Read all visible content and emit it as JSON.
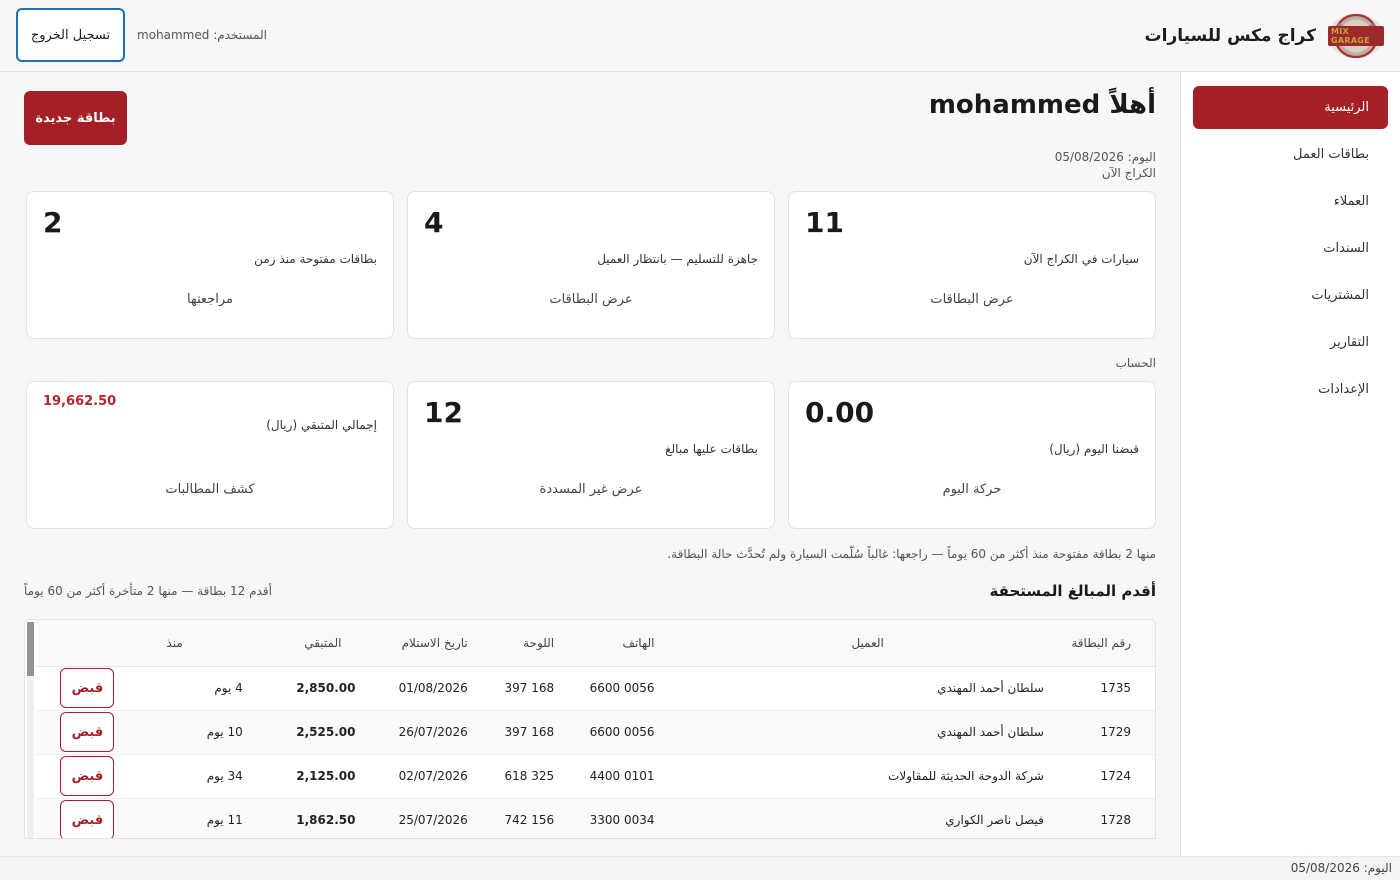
{
  "header": {
    "brand_title": "كراج مكس للسيارات",
    "logo_text": "MIX GARAGE",
    "user_label": "المستخدم: mohammed",
    "logout_label": "تسجيل الخروج"
  },
  "sidebar": {
    "items": [
      {
        "label": "الرئيسية",
        "active": true
      },
      {
        "label": "بطاقات العمل"
      },
      {
        "label": "العملاء"
      },
      {
        "label": "السندات"
      },
      {
        "label": "المشتريات"
      },
      {
        "label": "التقارير"
      },
      {
        "label": "الإعدادات"
      }
    ]
  },
  "main": {
    "greeting": "أهلاً mohammed",
    "today": "اليوم: 05/08/2026",
    "new_card_label": "بطاقة جديدة",
    "garage_section": "الكراج الآن",
    "account_section": "الحساب",
    "garage_cards": [
      {
        "value": "11",
        "label": "سيارات في الكراج الآن",
        "link": "عرض البطاقات"
      },
      {
        "value": "4",
        "label": "جاهزة للتسليم — بانتظار العميل",
        "link": "عرض البطاقات"
      },
      {
        "value": "2",
        "label": "بطاقات مفتوحة منذ زمن",
        "link": "مراجعتها"
      }
    ],
    "account_cards": [
      {
        "value": "0.00",
        "label": "قبضنا اليوم (ريال)",
        "link": "حركة اليوم"
      },
      {
        "value": "12",
        "label": "بطاقات عليها مبالغ",
        "link": "عرض غير المسددة"
      },
      {
        "value": "19,662.50",
        "label": "إجمالي المتبقي (ريال)",
        "link": "كشف المطالبات"
      }
    ],
    "note": "منها 2 بطاقة مفتوحة منذ أكثر من 60 يوماً — راجعها: غالباً سُلّمت السيارة ولم تُحدَّث حالة البطاقة.",
    "oldest_title": "أقدم المبالغ المستحقة",
    "oldest_subtitle": "أقدم 12 بطاقة — منها 2 متأخرة أكثر من 60 يوماً"
  },
  "table": {
    "headers": {
      "card_no": "رقم البطاقة",
      "client": "العميل",
      "phone": "الهاتف",
      "plate": "اللوحة",
      "received": "تاريخ الاستلام",
      "remaining": "المتبقي",
      "since": "منذ"
    },
    "pay_label": "قبض",
    "rows": [
      {
        "card_no": "1735",
        "client": "سلطان أحمد المهندي",
        "phone": "6600 0056",
        "plate": "397 168",
        "received": "01/08/2026",
        "remaining": "2,850.00",
        "since": "4 يوم"
      },
      {
        "card_no": "1729",
        "client": "سلطان أحمد المهندي",
        "phone": "6600 0056",
        "plate": "397 168",
        "received": "26/07/2026",
        "remaining": "2,525.00",
        "since": "10 يوم"
      },
      {
        "card_no": "1724",
        "client": "شركة الدوحة الحديثة للمقاولات",
        "phone": "4400 0101",
        "plate": "618 325",
        "received": "02/07/2026",
        "remaining": "2,125.00",
        "since": "34 يوم"
      },
      {
        "card_no": "1728",
        "client": "فيصل ناصر الكواري",
        "phone": "3300 0034",
        "plate": "742 156",
        "received": "25/07/2026",
        "remaining": "1,862.50",
        "since": "11 يوم"
      }
    ]
  },
  "footer": {
    "today": "اليوم: 05/08/2026"
  },
  "colors": {
    "accent": "#a51f27",
    "logout_border": "#1e6fb5",
    "amount_red": "#b3262e"
  }
}
